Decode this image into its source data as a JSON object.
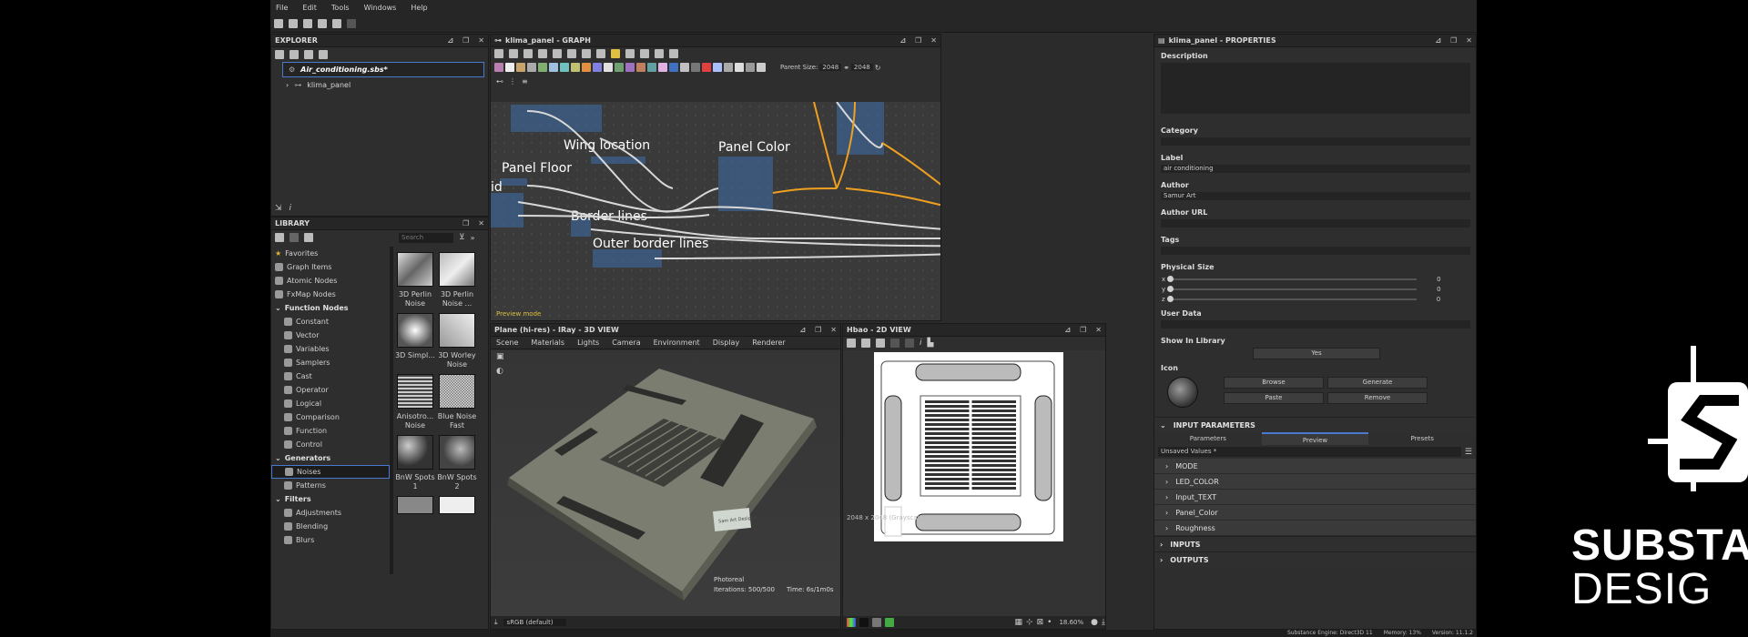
{
  "menu": [
    "File",
    "Edit",
    "Tools",
    "Windows",
    "Help"
  ],
  "explorer": {
    "title": "EXPLORER",
    "file": "Air_conditioning.sbs*",
    "graph": "klima_panel"
  },
  "library": {
    "title": "LIBRARY",
    "search_placeholder": "Search",
    "categories": [
      {
        "label": "Favorites"
      },
      {
        "label": "Graph Items"
      },
      {
        "label": "Atomic Nodes"
      },
      {
        "label": "FxMap Nodes"
      }
    ],
    "function_group": "Function Nodes",
    "function_items": [
      "Constant",
      "Vector",
      "Variables",
      "Samplers",
      "Cast",
      "Operator",
      "Logical",
      "Comparison",
      "Function",
      "Control"
    ],
    "generators_group": "Generators",
    "generator_items": [
      "Noises",
      "Patterns"
    ],
    "filters_group": "Filters",
    "filter_items": [
      "Adjustments",
      "Blending",
      "Blurs"
    ],
    "thumbs": [
      {
        "label": "3D Perlin Noise"
      },
      {
        "label": "3D Perlin Noise ..."
      },
      {
        "label": "3D Simpl..."
      },
      {
        "label": "3D Worley Noise"
      },
      {
        "label": "Anisotro... Noise"
      },
      {
        "label": "Blue Noise Fast"
      },
      {
        "label": "BnW Spots 1"
      },
      {
        "label": "BnW Spots 2"
      }
    ]
  },
  "graph": {
    "title": "klima_panel - GRAPH",
    "parent_size_label": "Parent Size:",
    "parent_size_value": "2048",
    "size_value": "2048",
    "frames": [
      "Wing location",
      "Panel Color",
      "Panel Floor",
      "Border lines",
      "Outer border lines"
    ],
    "partial_frame_label": "id",
    "preview_mode": "Preview mode"
  },
  "view3d": {
    "title": "Plane (hi-res) - IRay - 3D VIEW",
    "tabs": [
      "Scene",
      "Materials",
      "Lights",
      "Camera",
      "Environment",
      "Display",
      "Renderer"
    ],
    "renderer": "Photoreal",
    "iterations": "Iterations: 500/500",
    "time": "Time: 6s/1m0s",
    "colorspace": "sRGB (default)",
    "sticker_text": "Sam Art Designer"
  },
  "view2d": {
    "title": "Hbao - 2D VIEW",
    "footer": "2048 x 2048 (Grayscale, 16bpc)",
    "zoom": "18.60%"
  },
  "properties": {
    "title": "klima_panel - PROPERTIES",
    "description_label": "Description",
    "category_label": "Category",
    "label_label": "Label",
    "label_value": "air conditioning",
    "author_label": "Author",
    "author_value": "Samur Art",
    "author_url_label": "Author URL",
    "tags_label": "Tags",
    "physical_size_label": "Physical Size",
    "axes": [
      {
        "axis": "x",
        "value": "0"
      },
      {
        "axis": "y",
        "value": "0"
      },
      {
        "axis": "z",
        "value": "0"
      }
    ],
    "user_data_label": "User Data",
    "show_in_library_label": "Show In Library",
    "show_in_library_value": "Yes",
    "icon_label": "Icon",
    "buttons": {
      "browse": "Browse",
      "generate": "Generate",
      "paste": "Paste",
      "remove": "Remove"
    },
    "input_parameters_label": "INPUT PARAMETERS",
    "param_tabs": [
      "Parameters",
      "Preview",
      "Presets"
    ],
    "preset_value": "Unsaved Values *",
    "params": [
      "MODE",
      "LED_COLOR",
      "Input_TEXT",
      "Panel_Color",
      "Roughness"
    ],
    "inputs_label": "INPUTS",
    "outputs_label": "OUTPUTS"
  },
  "status": {
    "engine": "Substance Engine: Direct3D 11",
    "memory": "Memory: 13%",
    "version": "Version: 11.1.2"
  },
  "logo": {
    "line1": "SUBSTA",
    "line2": "DESIG"
  },
  "colors": {
    "accent": "#4a7ad0",
    "wire_orange": "#f0a020",
    "frame_blue": "#3c6eaa"
  }
}
